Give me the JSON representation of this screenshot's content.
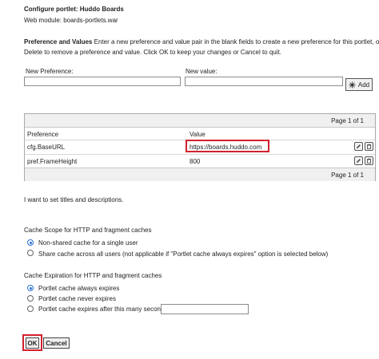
{
  "header": {
    "title": "Configure portlet: Huddo Boards",
    "web_module": "Web module: boards-portlets.war"
  },
  "prefs_section": {
    "heading": "Preference and Values",
    "instructions_line1": " Enter a new preference and value pair in the blank fields to create a new preference for this portlet, or click",
    "instructions_line2": "Delete to remove a preference and value. Click OK to keep your changes or Cancel to quit.",
    "new_pref_label": "New Preference:",
    "new_value_label": "New value:",
    "new_pref_value": "",
    "new_value_value": "",
    "add_label": "Add"
  },
  "table": {
    "pager_top": "Page 1 of 1",
    "pager_bottom": "Page 1 of 1",
    "col_preference": "Preference",
    "col_value": "Value",
    "rows": [
      {
        "name": "cfg.BaseURL",
        "value": "https://boards.huddo.com"
      },
      {
        "name": "pref.FrameHeight",
        "value": "800"
      }
    ]
  },
  "titles_link": "I want to set titles and descriptions.",
  "cache_scope": {
    "heading": "Cache Scope for HTTP and fragment caches",
    "options": [
      {
        "label": "Non-shared cache for a single user",
        "selected": true
      },
      {
        "label": "Share cache across all users (not applicable if \"Portlet cache always expires\" option is selected below)",
        "selected": false
      }
    ]
  },
  "cache_expiration": {
    "heading": "Cache Expiration for HTTP and fragment caches",
    "options": [
      {
        "label": "Portlet cache always expires",
        "selected": true
      },
      {
        "label": "Portlet cache never expires",
        "selected": false
      },
      {
        "label": "Portlet cache expires after this many seconds",
        "selected": false
      }
    ],
    "seconds_value": ""
  },
  "footer": {
    "ok_label": "OK",
    "cancel_label": "Cancel"
  },
  "colors": {
    "highlight": "#d2202d",
    "radio_accent": "#2a6fd6",
    "table_bar": "#f0f0f0"
  },
  "icons": {
    "add": "add-sparkle-icon",
    "edit": "pencil-icon",
    "delete": "trash-icon"
  }
}
